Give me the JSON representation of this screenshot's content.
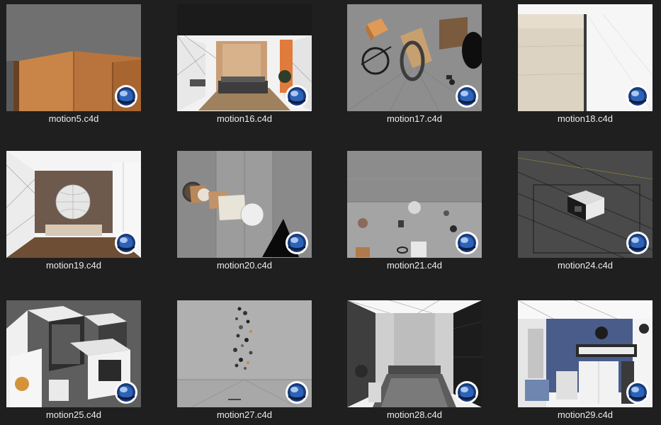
{
  "files": [
    {
      "name": "motion5.c4d",
      "scene": "wood-panel",
      "icon": "cinema4d-icon"
    },
    {
      "name": "motion16.c4d",
      "scene": "bedroom-wood",
      "icon": "cinema4d-icon"
    },
    {
      "name": "motion17.c4d",
      "scene": "floating-objects",
      "icon": "cinema4d-icon"
    },
    {
      "name": "motion18.c4d",
      "scene": "light-panel",
      "icon": "cinema4d-icon"
    },
    {
      "name": "motion19.c4d",
      "scene": "bedroom-sphere",
      "icon": "cinema4d-icon"
    },
    {
      "name": "motion20.c4d",
      "scene": "concrete-primitives",
      "icon": "cinema4d-icon"
    },
    {
      "name": "motion21.c4d",
      "scene": "concrete-scatter",
      "icon": "cinema4d-icon"
    },
    {
      "name": "motion24.c4d",
      "scene": "dark-viewport",
      "icon": "cinema4d-icon"
    },
    {
      "name": "motion25.c4d",
      "scene": "room-modules",
      "icon": "cinema4d-icon"
    },
    {
      "name": "motion27.c4d",
      "scene": "grey-scatter",
      "icon": "cinema4d-icon"
    },
    {
      "name": "motion28.c4d",
      "scene": "bedroom-grey",
      "icon": "cinema4d-icon"
    },
    {
      "name": "motion29.c4d",
      "scene": "blue-room",
      "icon": "cinema4d-icon"
    }
  ]
}
